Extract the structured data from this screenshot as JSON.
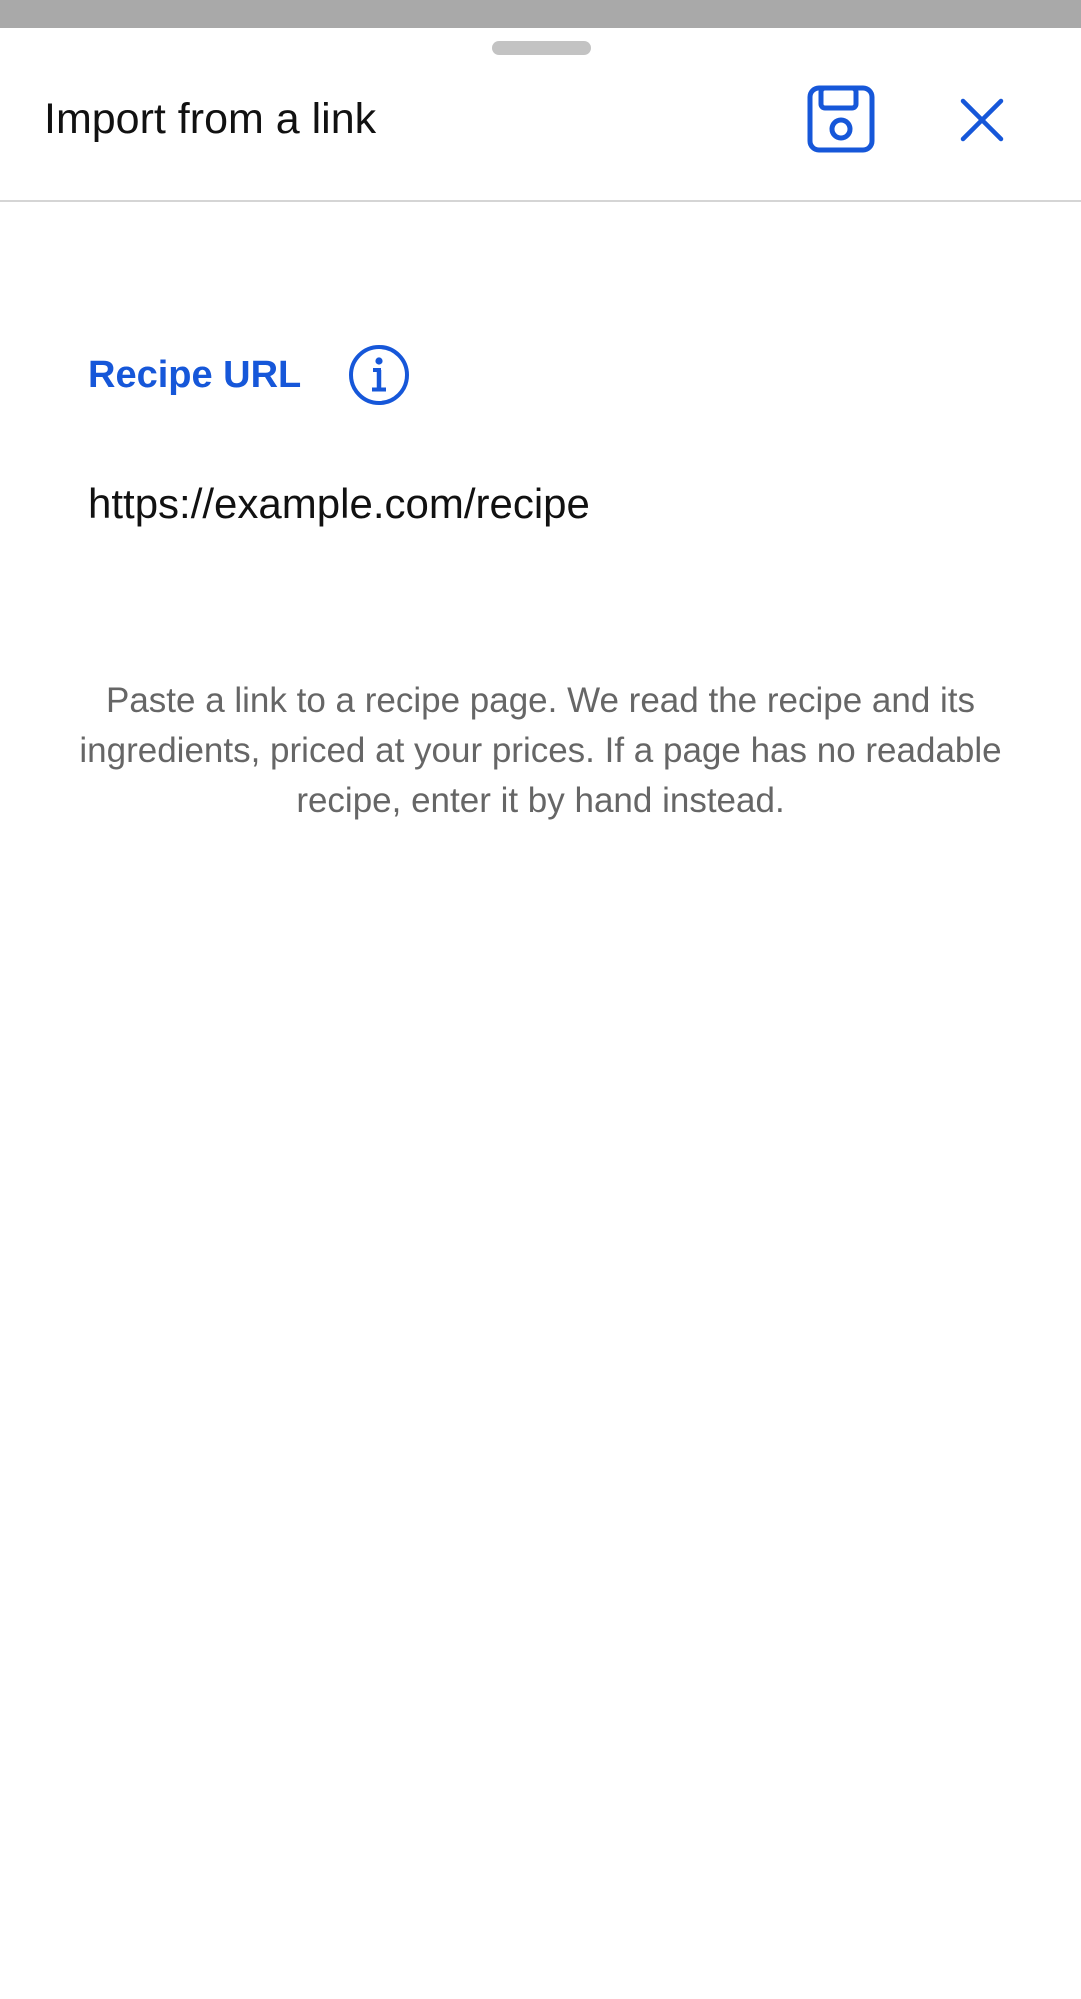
{
  "header": {
    "title": "Import from a link",
    "save_icon": "save-icon",
    "close_icon": "close-icon"
  },
  "form": {
    "url_label": "Recipe URL",
    "info_icon": "info-icon",
    "url_value": "https://example.com/recipe",
    "help_text": "Paste a link to a recipe page. We read the recipe and its ingredients, priced at your prices. If a page has no readable recipe, enter it by hand instead."
  },
  "colors": {
    "accent": "#1657d9",
    "overlay": "#a9a9a9",
    "divider": "#d5d5d5",
    "help_text": "#666666"
  }
}
